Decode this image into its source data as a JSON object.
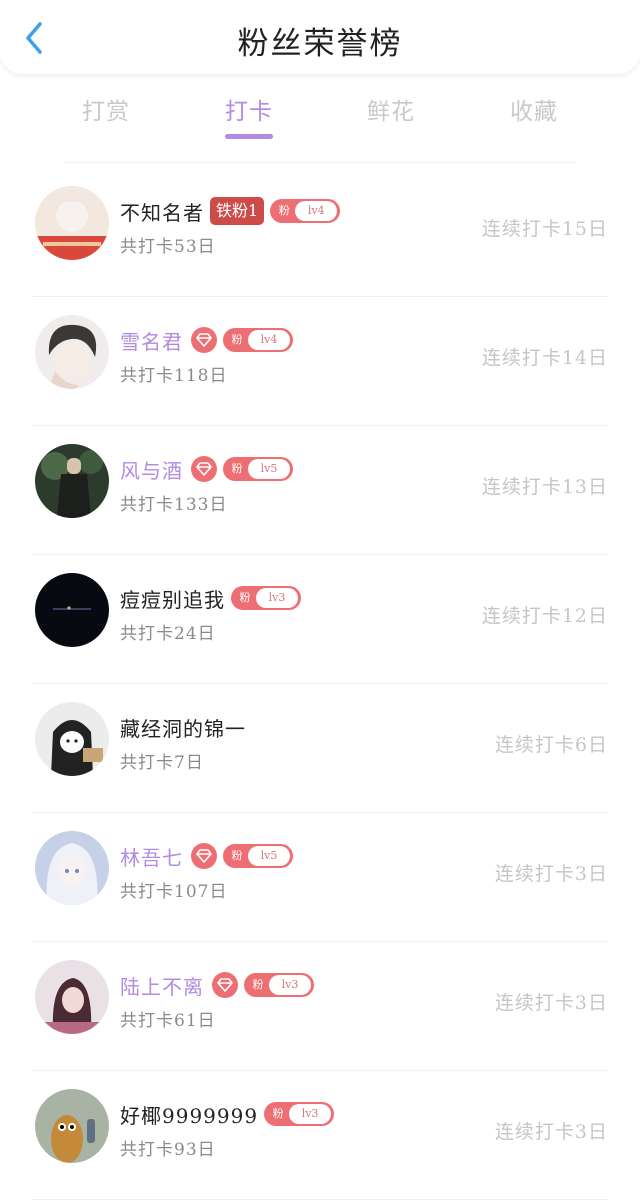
{
  "header": {
    "title": "粉丝荣誉榜",
    "back_icon": "chevron-left-icon"
  },
  "tabs": [
    {
      "label": "打赏",
      "active": false
    },
    {
      "label": "打卡",
      "active": true
    },
    {
      "label": "鲜花",
      "active": false
    },
    {
      "label": "收藏",
      "active": false
    }
  ],
  "colors": {
    "accent": "#b48be0",
    "badge": "#ee6f73",
    "medal": "#cd4c4a"
  },
  "fans": [
    {
      "name": "不知名者",
      "vip": false,
      "medal": "铁粉1",
      "diamond": false,
      "fan_label": "粉",
      "level": "lv4",
      "total": "共打卡53日",
      "streak": "连续打卡15日"
    },
    {
      "name": "雪名君",
      "vip": true,
      "medal": "",
      "diamond": true,
      "fan_label": "粉",
      "level": "lv4",
      "total": "共打卡118日",
      "streak": "连续打卡14日"
    },
    {
      "name": "风与酒",
      "vip": true,
      "medal": "",
      "diamond": true,
      "fan_label": "粉",
      "level": "lv5",
      "total": "共打卡133日",
      "streak": "连续打卡13日"
    },
    {
      "name": "痘痘别追我",
      "vip": false,
      "medal": "",
      "diamond": false,
      "fan_label": "粉",
      "level": "lv3",
      "total": "共打卡24日",
      "streak": "连续打卡12日"
    },
    {
      "name": "藏经洞的锦一",
      "vip": false,
      "medal": "",
      "diamond": false,
      "fan_label": "",
      "level": "",
      "total": "共打卡7日",
      "streak": "连续打卡6日"
    },
    {
      "name": "林吾七",
      "vip": true,
      "medal": "",
      "diamond": true,
      "fan_label": "粉",
      "level": "lv5",
      "total": "共打卡107日",
      "streak": "连续打卡3日"
    },
    {
      "name": "陆上不离",
      "vip": true,
      "medal": "",
      "diamond": true,
      "fan_label": "粉",
      "level": "lv3",
      "total": "共打卡61日",
      "streak": "连续打卡3日"
    },
    {
      "name": "好椰9999999",
      "vip": false,
      "medal": "",
      "diamond": false,
      "fan_label": "粉",
      "level": "lv3",
      "total": "共打卡93日",
      "streak": "连续打卡3日"
    }
  ]
}
